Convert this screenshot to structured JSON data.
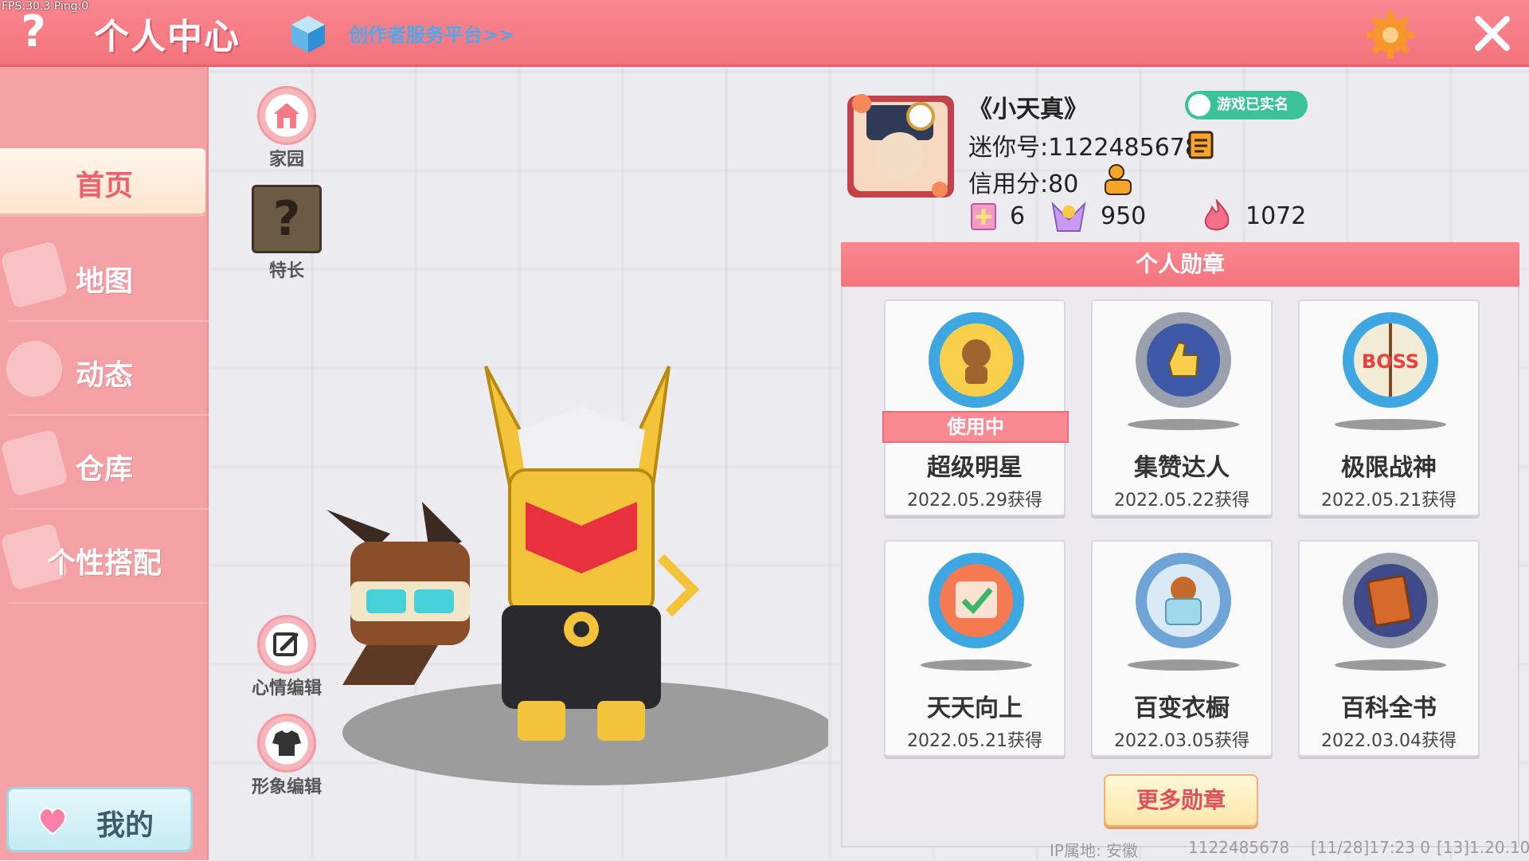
{
  "debug": {
    "fps": "FPS:30.3  Ping:0"
  },
  "header": {
    "help": "?",
    "title": "个人中心",
    "platform_link": "创作者服务平台>>"
  },
  "sidebar": {
    "items": [
      {
        "label": "首页",
        "active": true
      },
      {
        "label": "地图"
      },
      {
        "label": "动态"
      },
      {
        "label": "仓库"
      },
      {
        "label": "个性搭配"
      }
    ],
    "me": "我的"
  },
  "actions": {
    "home": "家园",
    "talent": "特长",
    "mood_edit": "心情编辑",
    "avatar_edit": "形象编辑"
  },
  "profile": {
    "nickname": "《小天真》",
    "realname_badge": "游戏已实名",
    "mini_id": "迷你号:1122485678",
    "credit": "信用分:80",
    "stats": {
      "friends": "6",
      "likes": "950",
      "heat": "1072"
    }
  },
  "medals": {
    "title": "个人勋章",
    "in_use": "使用中",
    "items": [
      {
        "name": "超级明星",
        "date": "2022.05.29获得",
        "color": "#3ea6e0"
      },
      {
        "name": "集赞达人",
        "date": "2022.05.22获得",
        "color": "#9aa1ad"
      },
      {
        "name": "极限战神",
        "date": "2022.05.21获得",
        "color": "#3ea6e0"
      },
      {
        "name": "天天向上",
        "date": "2022.05.21获得",
        "color": "#3ea6e0"
      },
      {
        "name": "百变衣橱",
        "date": "2022.03.05获得",
        "color": "#6fa4d6"
      },
      {
        "name": "百科全书",
        "date": "2022.03.04获得",
        "color": "#9aa1ad"
      }
    ],
    "more": "更多勋章"
  },
  "footer": {
    "ip": "IP属地: 安徽",
    "uid": "1122485678",
    "time": "[11/28]17:23 0",
    "version": "[13]1.20.10"
  },
  "colors": {
    "accent": "#f4757e",
    "sidebar": "#f4a1a6",
    "badge": "#3bc29a"
  }
}
